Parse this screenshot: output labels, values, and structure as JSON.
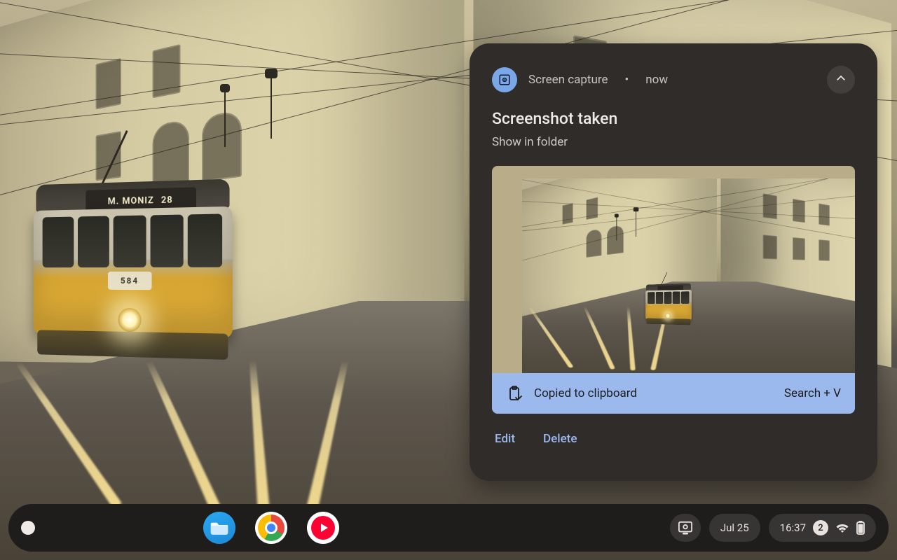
{
  "wallpaper": {
    "tram_route": "M. MONIZ",
    "tram_route_no": "28",
    "tram_fleet_no": "584"
  },
  "notification": {
    "source": "Screen capture",
    "separator": "•",
    "time": "now",
    "title": "Screenshot taken",
    "subtitle": "Show in folder",
    "clipboard_label": "Copied to clipboard",
    "clipboard_shortcut": "Search + V",
    "actions": {
      "edit": "Edit",
      "delete": "Delete"
    }
  },
  "shelf": {
    "date": "Jul 25",
    "time": "16:37",
    "notification_count": "2"
  }
}
